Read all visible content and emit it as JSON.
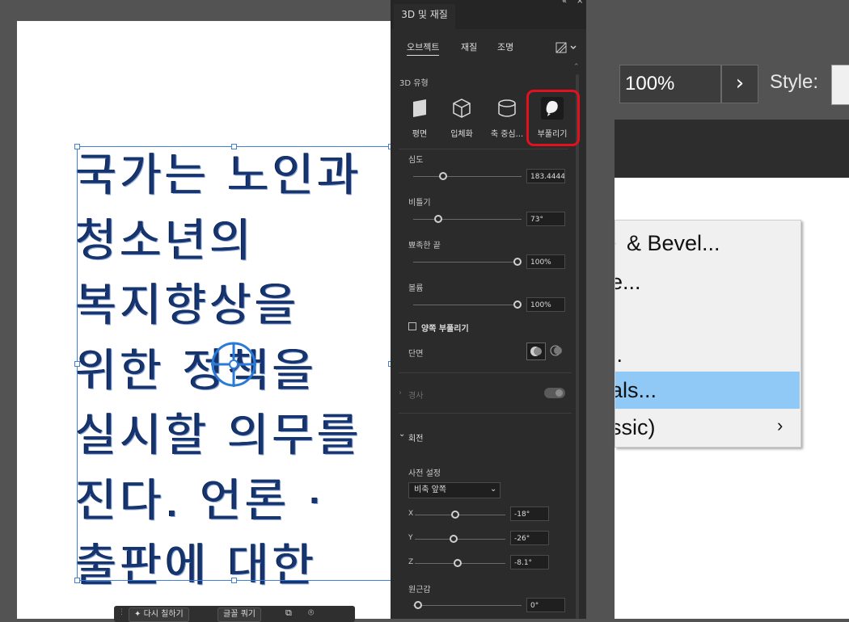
{
  "panel": {
    "title": "3D 및 재질",
    "subtabs": [
      "오브젝트",
      "재질",
      "조명"
    ],
    "type_label": "3D 유형",
    "types": [
      "평면",
      "입체화",
      "축 중심...",
      "부풀리기"
    ],
    "depth": {
      "label": "심도",
      "value": "183.4444"
    },
    "twist": {
      "label": "비틀기",
      "value": "73°"
    },
    "taper": {
      "label": "뾰족한 끝",
      "value": "100%"
    },
    "volume": {
      "label": "볼륨",
      "value": "100%"
    },
    "inflate_both": "양쪽 부풀리기",
    "cap_label": "단면",
    "bevel_label": "경사",
    "rotation_label": "회전",
    "preset_label": "사전 설정",
    "preset_value": "비축 앞쪽",
    "x": {
      "label": "X",
      "value": "-18°"
    },
    "y": {
      "label": "Y",
      "value": "-26°"
    },
    "z": {
      "label": "Z",
      "value": "-8.1°"
    },
    "perspective": {
      "label": "원근감",
      "value": "0°"
    }
  },
  "artwork": {
    "lines": [
      "국가는 노인과",
      "청소년의",
      "복지향상을",
      "위한 정책을",
      "실시할 의무를",
      "진다. 언론 ·",
      "출판에 대한"
    ]
  },
  "context_toolbar": {
    "btn1": "다시 칠하기",
    "btn2": "글꼴 쿼기"
  },
  "right_window": {
    "zoom": "100%",
    "style_label": "Style:",
    "menu_items": [
      "& Bevel...",
      "e...",
      ".",
      "..",
      "als...",
      "ssic)"
    ]
  },
  "colors": {
    "highlight": "#e3101e",
    "selection": "#3f7fd6",
    "menu_hover": "#90c8f6"
  }
}
